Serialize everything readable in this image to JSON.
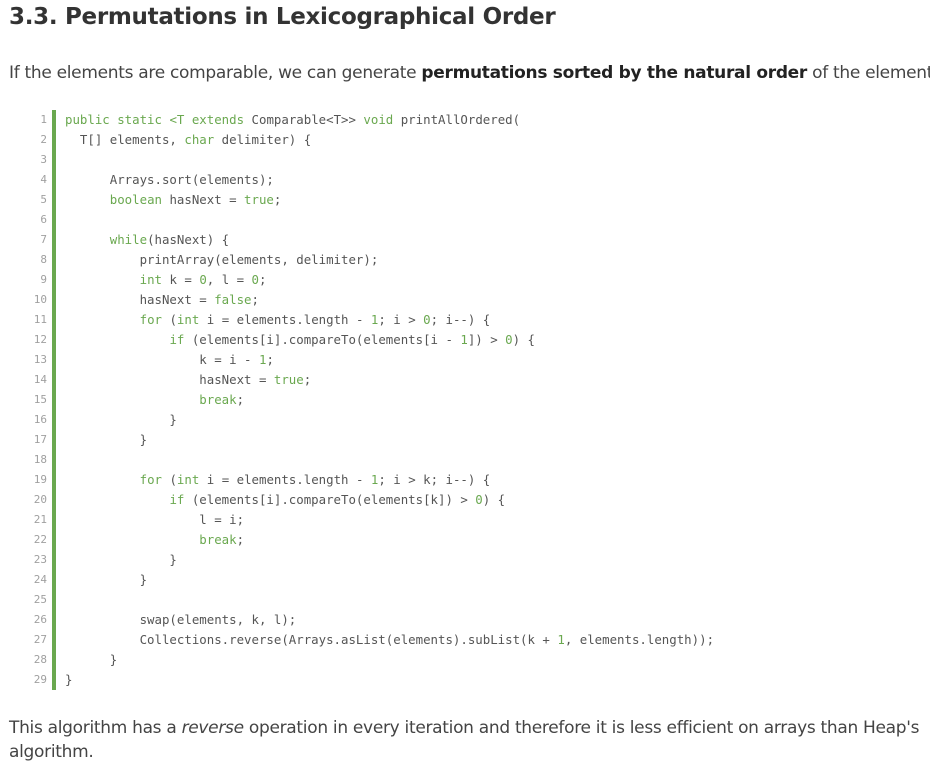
{
  "article": {
    "heading": "3.3. Permutations in Lexicographical Order",
    "intro": {
      "before": "If the elements are comparable, we can generate ",
      "bold": "permutations sorted by the natural order",
      "after": " of the elements:"
    },
    "outro": {
      "before": "This algorithm has a ",
      "italic": "reverse",
      "after": " operation in every iteration and therefore it is less efficient on arrays than Heap's algorithm."
    }
  },
  "code": {
    "line_numbers": [
      "1",
      "2",
      "3",
      "4",
      "5",
      "6",
      "7",
      "8",
      "9",
      "10",
      "11",
      "12",
      "13",
      "14",
      "15",
      "16",
      "17",
      "18",
      "19",
      "20",
      "21",
      "22",
      "23",
      "24",
      "25",
      "26",
      "27",
      "28",
      "29"
    ],
    "lines": [
      [
        {
          "t": "public static",
          "k": "kw"
        },
        {
          "t": " "
        },
        {
          "t": "<T extends",
          "k": "kw"
        },
        {
          "t": " Comparable<T>> "
        },
        {
          "t": "void",
          "k": "kw"
        },
        {
          "t": " printAllOrdered("
        }
      ],
      [
        {
          "t": "  T[] elements, "
        },
        {
          "t": "char",
          "k": "kw"
        },
        {
          "t": " delimiter) {"
        }
      ],
      [],
      [
        {
          "t": "      Arrays.sort(elements);"
        }
      ],
      [
        {
          "t": "      "
        },
        {
          "t": "boolean",
          "k": "kw"
        },
        {
          "t": " hasNext = "
        },
        {
          "t": "true",
          "k": "kw"
        },
        {
          "t": ";"
        }
      ],
      [],
      [
        {
          "t": "      "
        },
        {
          "t": "while",
          "k": "kw"
        },
        {
          "t": "(hasNext) {"
        }
      ],
      [
        {
          "t": "          printArray(elements, delimiter);"
        }
      ],
      [
        {
          "t": "          "
        },
        {
          "t": "int",
          "k": "kw"
        },
        {
          "t": " k = "
        },
        {
          "t": "0",
          "k": "num"
        },
        {
          "t": ", l = "
        },
        {
          "t": "0",
          "k": "num"
        },
        {
          "t": ";"
        }
      ],
      [
        {
          "t": "          hasNext = "
        },
        {
          "t": "false",
          "k": "kw"
        },
        {
          "t": ";"
        }
      ],
      [
        {
          "t": "          "
        },
        {
          "t": "for",
          "k": "kw"
        },
        {
          "t": " ("
        },
        {
          "t": "int",
          "k": "kw"
        },
        {
          "t": " i = elements.length - "
        },
        {
          "t": "1",
          "k": "num"
        },
        {
          "t": "; i > "
        },
        {
          "t": "0",
          "k": "num"
        },
        {
          "t": "; i--) {"
        }
      ],
      [
        {
          "t": "              "
        },
        {
          "t": "if",
          "k": "kw"
        },
        {
          "t": " (elements[i].compareTo(elements[i - "
        },
        {
          "t": "1",
          "k": "num"
        },
        {
          "t": "]) > "
        },
        {
          "t": "0",
          "k": "num"
        },
        {
          "t": ") {"
        }
      ],
      [
        {
          "t": "                  k = i - "
        },
        {
          "t": "1",
          "k": "num"
        },
        {
          "t": ";"
        }
      ],
      [
        {
          "t": "                  hasNext = "
        },
        {
          "t": "true",
          "k": "kw"
        },
        {
          "t": ";"
        }
      ],
      [
        {
          "t": "                  "
        },
        {
          "t": "break",
          "k": "kw"
        },
        {
          "t": ";"
        }
      ],
      [
        {
          "t": "              }"
        }
      ],
      [
        {
          "t": "          }"
        }
      ],
      [],
      [
        {
          "t": "          "
        },
        {
          "t": "for",
          "k": "kw"
        },
        {
          "t": " ("
        },
        {
          "t": "int",
          "k": "kw"
        },
        {
          "t": " i = elements.length - "
        },
        {
          "t": "1",
          "k": "num"
        },
        {
          "t": "; i > k; i--) {"
        }
      ],
      [
        {
          "t": "              "
        },
        {
          "t": "if",
          "k": "kw"
        },
        {
          "t": " (elements[i].compareTo(elements[k]) > "
        },
        {
          "t": "0",
          "k": "num"
        },
        {
          "t": ") {"
        }
      ],
      [
        {
          "t": "                  l = i;"
        }
      ],
      [
        {
          "t": "                  "
        },
        {
          "t": "break",
          "k": "kw"
        },
        {
          "t": ";"
        }
      ],
      [
        {
          "t": "              }"
        }
      ],
      [
        {
          "t": "          }"
        }
      ],
      [],
      [
        {
          "t": "          swap(elements, k, l);"
        }
      ],
      [
        {
          "t": "          Collections.reverse(Arrays.asList(elements).subList(k + "
        },
        {
          "t": "1",
          "k": "num"
        },
        {
          "t": ", elements.length));"
        }
      ],
      [
        {
          "t": "      }"
        }
      ],
      [
        {
          "t": "}"
        }
      ]
    ]
  },
  "colors": {
    "accent_green": "#6aa84f",
    "text": "#333333",
    "line_number": "#a0a0a0"
  }
}
